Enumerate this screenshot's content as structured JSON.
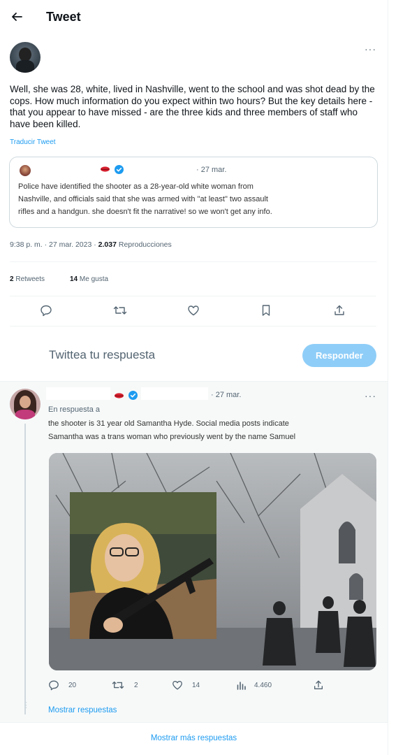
{
  "header": {
    "title": "Tweet"
  },
  "main_tweet": {
    "text": "Well, she was 28, white, lived in Nashville, went to the school and was shot dead by the cops. How much information do you expect within two hours? But the key details here - that you appear to have missed - are the three kids and three members of staff who have been killed.",
    "translate_label": "Traducir Tweet",
    "timestamp": "9:38 p. m. · 27 mar. 2023 · ",
    "views_count": "2.037",
    "views_label": " Reproducciones",
    "retweets_count": "2",
    "retweets_label": " Retweets",
    "likes_count": "14",
    "likes_label": " Me gusta"
  },
  "quoted_tweet": {
    "date": "· 27 mar.",
    "text_line1": "Police have identified the shooter as a 28-year-old white woman from",
    "text_line2": "Nashville, and officials said that she was armed with \"at least\" two assault",
    "text_line3": "rifles and a handgun.  she doesn't fit the narrative! so we won't get any info."
  },
  "reply_box": {
    "placeholder": "Twittea tu respuesta",
    "button_label": "Responder"
  },
  "reply": {
    "date": "· 27 mar.",
    "in_reply_to": "En respuesta a",
    "text_line1": "the shooter is 31 year old Samantha Hyde. Social media posts indicate",
    "text_line2": "Samantha was a trans woman who previously went by the name Samuel",
    "reply_count": "20",
    "retweet_count": "2",
    "like_count": "14",
    "view_count": "4.460"
  },
  "show_replies": "Mostrar respuestas",
  "show_more_replies": "Mostrar más respuestas"
}
